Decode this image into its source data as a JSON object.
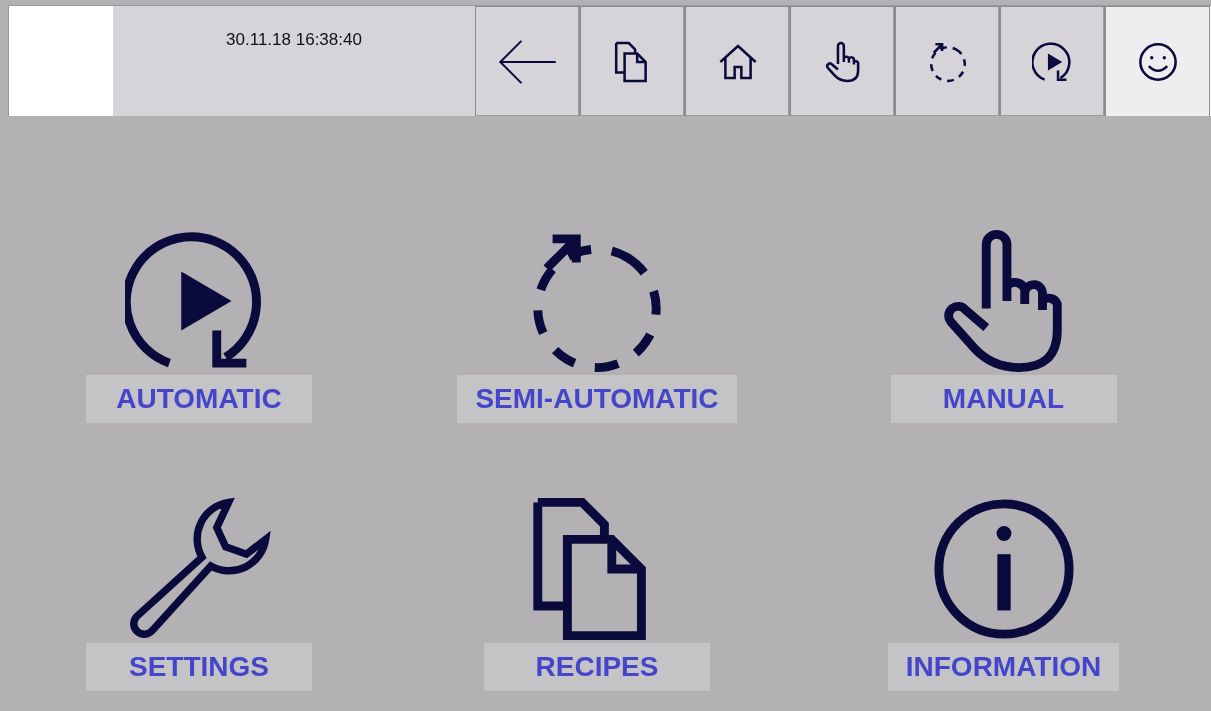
{
  "header": {
    "datetime": "30.11.18 16:38:40"
  },
  "toolbar": [
    {
      "kind": "back",
      "selected": false
    },
    {
      "kind": "recipes",
      "selected": false
    },
    {
      "kind": "home",
      "selected": false
    },
    {
      "kind": "manual",
      "selected": false
    },
    {
      "kind": "semi",
      "selected": false
    },
    {
      "kind": "auto",
      "selected": false
    },
    {
      "kind": "user",
      "selected": true
    }
  ],
  "tiles": [
    {
      "kind": "auto",
      "label": "AUTOMATIC"
    },
    {
      "kind": "semi",
      "label": "SEMI-AUTOMATIC"
    },
    {
      "kind": "manual",
      "label": "MANUAL"
    },
    {
      "kind": "settings",
      "label": "SETTINGS"
    },
    {
      "kind": "recipes",
      "label": "RECIPES"
    },
    {
      "kind": "info",
      "label": "INFORMATION"
    }
  ]
}
